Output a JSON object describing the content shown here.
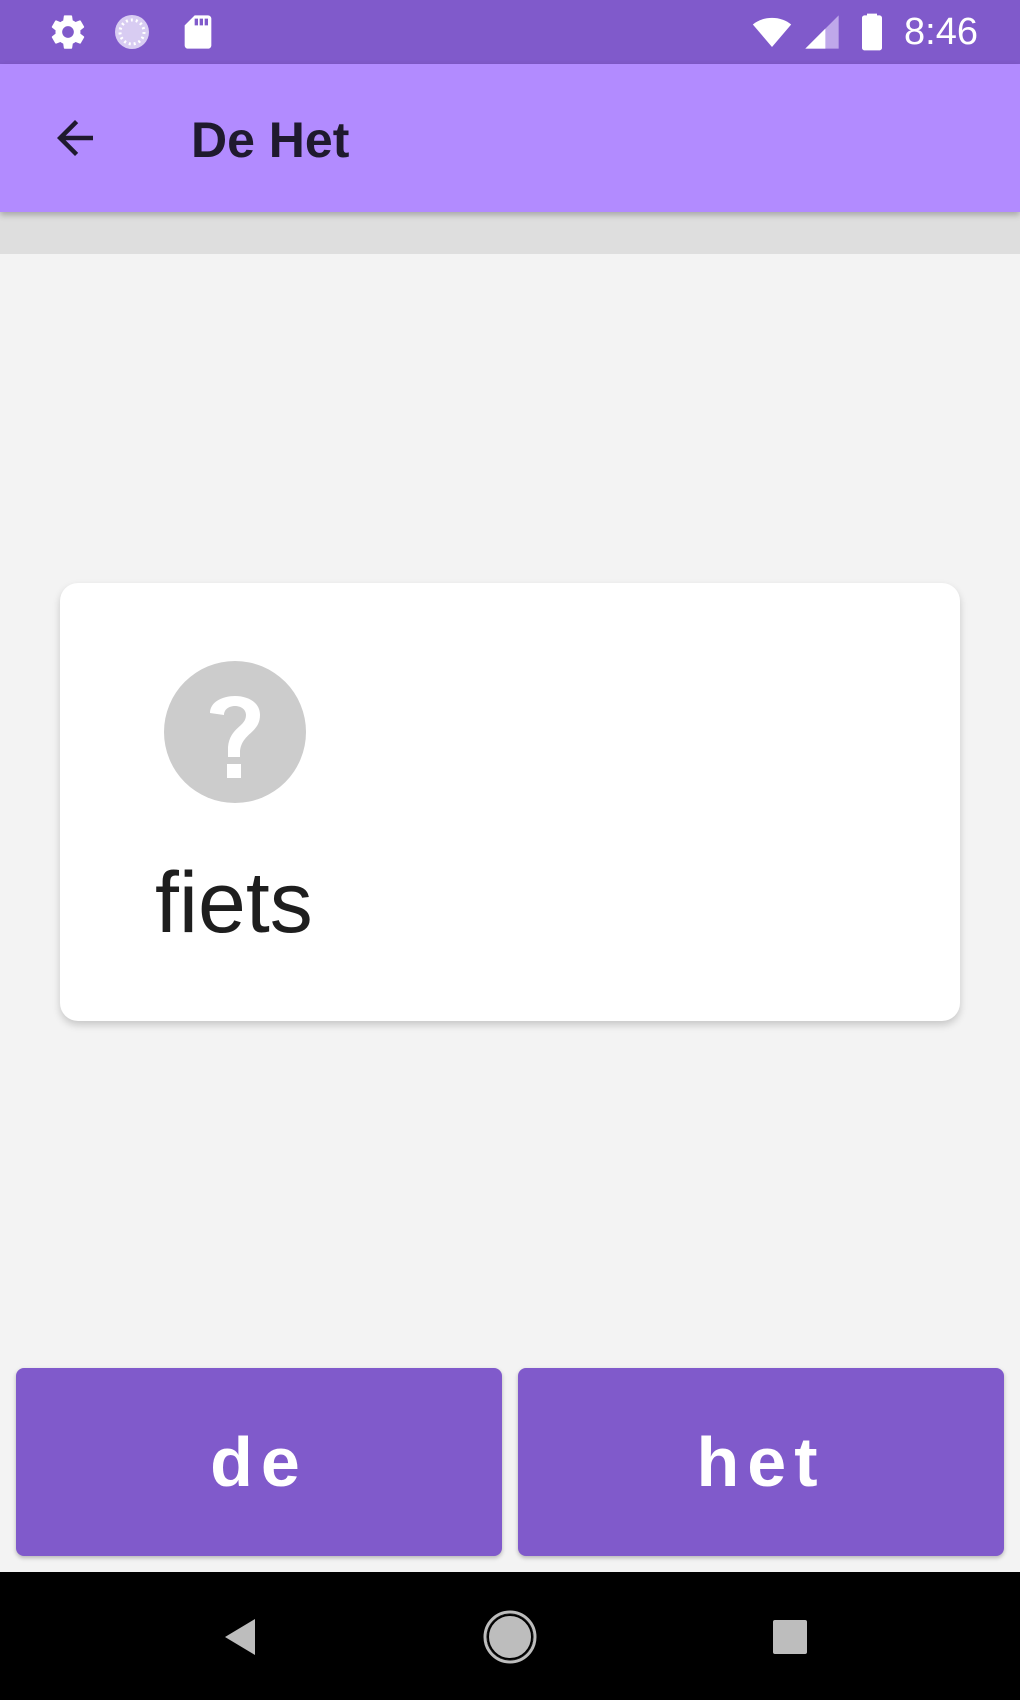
{
  "status_bar": {
    "time": "8:46",
    "icons": [
      "settings-icon",
      "sync-icon",
      "sd-card-icon",
      "wifi-icon",
      "signal-icon",
      "battery-icon"
    ],
    "background": "#805acb"
  },
  "app_bar": {
    "title": "De Het",
    "back_icon": "arrow-back-icon",
    "background": "#b28bff"
  },
  "card": {
    "icon": "help-circle-icon",
    "word": "fiets"
  },
  "answers": {
    "de_label": "de",
    "het_label": "het",
    "button_color": "#805acb"
  },
  "nav_bar": {
    "icons": [
      "back-triangle-icon",
      "home-circle-icon",
      "recents-square-icon"
    ]
  }
}
